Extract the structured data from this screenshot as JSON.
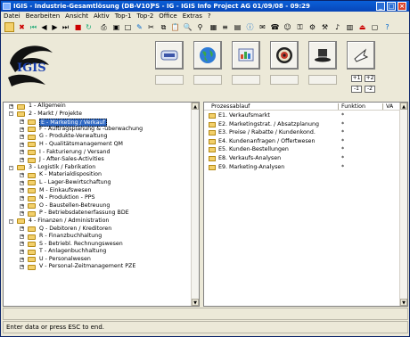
{
  "window": {
    "title_left": "IGIS - Industrie-Gesamtlösung    (DB-V10)",
    "title_right": "PS - IG - IGIS Info Project AG          01/09/08 - 09:29",
    "min": "_",
    "max": "□",
    "close": "×"
  },
  "menu": [
    "Datei",
    "Bearbeiten",
    "Ansicht",
    "Aktiv",
    "Top-1",
    "Top-2",
    "Office",
    "Extras",
    "?"
  ],
  "logo": {
    "text": "IGIS"
  },
  "side_buttons": {
    "plus1": "+1",
    "plus2": "+2",
    "minus1": "-1",
    "minus2": "-2"
  },
  "colors": {
    "titlebar": "#0a5fd8",
    "selection": "#316ac5",
    "folder": "#f3d06b"
  },
  "tree": [
    {
      "level": 0,
      "expander": "+",
      "label": "1  - Allgemein"
    },
    {
      "level": 0,
      "expander": "-",
      "label": "2  - Markt / Projekte"
    },
    {
      "level": 1,
      "expander": "+",
      "label": "E  - Marketing / Verkauf",
      "selected": true
    },
    {
      "level": 1,
      "expander": "+",
      "label": "F  - Auftragsplanung & -überwachung"
    },
    {
      "level": 1,
      "expander": "+",
      "label": "G  - Produkte-Verwaltung"
    },
    {
      "level": 1,
      "expander": "+",
      "label": "H  - Qualitätsmanagement QM"
    },
    {
      "level": 1,
      "expander": "+",
      "label": "I   - Fakturierung / Versand"
    },
    {
      "level": 1,
      "expander": "+",
      "label": "J  - After-Sales-Activities"
    },
    {
      "level": 0,
      "expander": "-",
      "label": "3  - Logistik / Fabrikation"
    },
    {
      "level": 1,
      "expander": "+",
      "label": "K  - Materialdisposition"
    },
    {
      "level": 1,
      "expander": "+",
      "label": "L  - Lager-Bewirtschaftung"
    },
    {
      "level": 1,
      "expander": "+",
      "label": "M  - Einkaufswesen"
    },
    {
      "level": 1,
      "expander": "+",
      "label": "N  - Produktion - PPS"
    },
    {
      "level": 1,
      "expander": "+",
      "label": "O  - Baustellen-Betreuung"
    },
    {
      "level": 1,
      "expander": "+",
      "label": "P  - Betriebsdatenerfassung BDE"
    },
    {
      "level": 0,
      "expander": "-",
      "label": "4  - Finanzen / Administration"
    },
    {
      "level": 1,
      "expander": "+",
      "label": "Q  - Debitoren / Kreditoren"
    },
    {
      "level": 1,
      "expander": "+",
      "label": "R  - Finanzbuchhaltung"
    },
    {
      "level": 1,
      "expander": "+",
      "label": "S  - Betriebl. Rechnungswesen"
    },
    {
      "level": 1,
      "expander": "+",
      "label": "T  - Anlagenbuchhaltung"
    },
    {
      "level": 1,
      "expander": "+",
      "label": "U  - Personalwesen"
    },
    {
      "level": 1,
      "expander": "+",
      "label": "V  - Personal-Zeitmanagement PZE"
    }
  ],
  "process": {
    "headers": {
      "col1": "Prozessablauf",
      "col2": "Funktion",
      "col3": "VA"
    },
    "rows": [
      {
        "label": "E1.  Verkaufsmarkt",
        "fn": "*"
      },
      {
        "label": "E2.  Marketingstrat. / Absatzplanung",
        "fn": "*"
      },
      {
        "label": "E3.  Preise / Rabatte / Kundenkond.",
        "fn": "*"
      },
      {
        "label": "E4.  Kundenanfragen / Offertwesen",
        "fn": "*"
      },
      {
        "label": "E5.  Kunden-Bestellungen",
        "fn": "*"
      },
      {
        "label": "E8.  Verkaufs-Analysen",
        "fn": "*"
      },
      {
        "label": "E9.  Marketing-Analysen",
        "fn": "*"
      }
    ]
  },
  "statusbar": {
    "message": "Enter data or press ESC to end."
  }
}
